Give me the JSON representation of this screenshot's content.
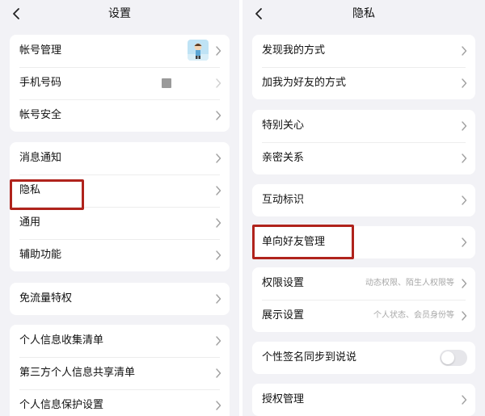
{
  "left": {
    "title": "设置",
    "groups": [
      {
        "items": [
          {
            "label": "帐号管理"
          },
          {
            "label": "手机号码"
          },
          {
            "label": "帐号安全"
          }
        ]
      },
      {
        "items": [
          {
            "label": "消息通知"
          },
          {
            "label": "隐私"
          },
          {
            "label": "通用"
          },
          {
            "label": "辅助功能"
          }
        ]
      },
      {
        "items": [
          {
            "label": "免流量特权"
          }
        ]
      },
      {
        "items": [
          {
            "label": "个人信息收集清单"
          },
          {
            "label": "第三方个人信息共享清单"
          },
          {
            "label": "个人信息保护设置"
          }
        ]
      }
    ]
  },
  "right": {
    "title": "隐私",
    "groups": [
      {
        "items": [
          {
            "label": "发现我的方式"
          },
          {
            "label": "加我为好友的方式"
          }
        ]
      },
      {
        "items": [
          {
            "label": "特别关心"
          },
          {
            "label": "亲密关系"
          }
        ]
      },
      {
        "items": [
          {
            "label": "互动标识"
          }
        ]
      },
      {
        "items": [
          {
            "label": "单向好友管理"
          }
        ]
      },
      {
        "items": [
          {
            "label": "权限设置",
            "sub": "动态权限、陌生人权限等"
          },
          {
            "label": "展示设置",
            "sub": "个人状态、会员身份等"
          }
        ]
      },
      {
        "items": [
          {
            "label": "个性签名同步到说说",
            "toggle_on": false
          }
        ]
      },
      {
        "items": [
          {
            "label": "授权管理"
          }
        ]
      }
    ]
  },
  "icons": {
    "back": "chevron-left-icon",
    "chevron": "chevron-right-icon"
  },
  "colors": {
    "highlight": "#b0231c",
    "background": "#f2f2f6",
    "card": "#ffffff"
  }
}
